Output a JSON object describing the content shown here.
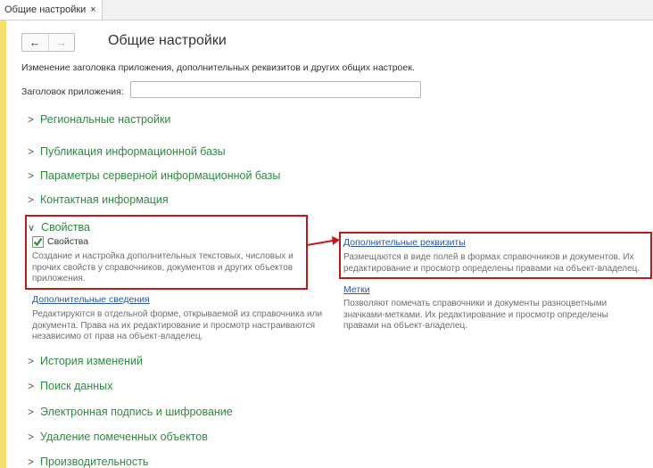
{
  "tab": {
    "label": "Общие настройки",
    "close": "×"
  },
  "nav": {
    "back": "←",
    "forward": "→"
  },
  "page": {
    "title": "Общие настройки",
    "description": "Изменение заголовка приложения, дополнительных реквизитов и других общих настроек.",
    "app_title_label": "Заголовок приложения:",
    "app_title_value": ""
  },
  "sections": {
    "regional": "Региональные настройки",
    "publication": "Публикация информационной базы",
    "server_params": "Параметры серверной информационной базы",
    "contact_info": "Контактная информация",
    "properties": "Свойства",
    "history": "История изменений",
    "search": "Поиск данных",
    "signature": "Электронная подпись и шифрование",
    "deletion": "Удаление помеченных объектов",
    "performance": "Производительность"
  },
  "properties": {
    "checkbox_label": "Свойства",
    "checkbox_checked": true,
    "checkbox_desc_1": "Создание и настройка дополнительных текстовых, числовых и",
    "checkbox_desc_2": "прочих свойств у справочников, документов и других объектов",
    "checkbox_desc_3": "приложения.",
    "add_info_link": "Дополнительные сведения",
    "add_info_desc_1": "Редактируются в отдельной форме, открываемой из справочника или",
    "add_info_desc_2": "документа. Права на их редактирование и просмотр настраиваются",
    "add_info_desc_3": "независимо от прав на объект-владелец.",
    "add_attr_link": "Дополнительные реквизиты",
    "add_attr_desc_1": "Размещаются в виде полей в формах справочников и документов. Их",
    "add_attr_desc_2": "редактирование и просмотр определены правами на объект-владелец.",
    "tags_link": "Метки",
    "tags_desc_1": "Позволяют помечать справочники и документы разноцветными",
    "tags_desc_2": "значками-метками. Их редактирование и просмотр определены",
    "tags_desc_3": "правами на объект-владелец."
  },
  "colors": {
    "section_text": "#2e8a3e",
    "link": "#2a56a8",
    "annotation": "#c01818",
    "left_strip": "#f5e06e"
  },
  "icons": {
    "expand": "chevron-right-icon",
    "collapse": "chevron-down-icon",
    "check": "check-icon",
    "arrow": "annotation-arrow-icon"
  }
}
